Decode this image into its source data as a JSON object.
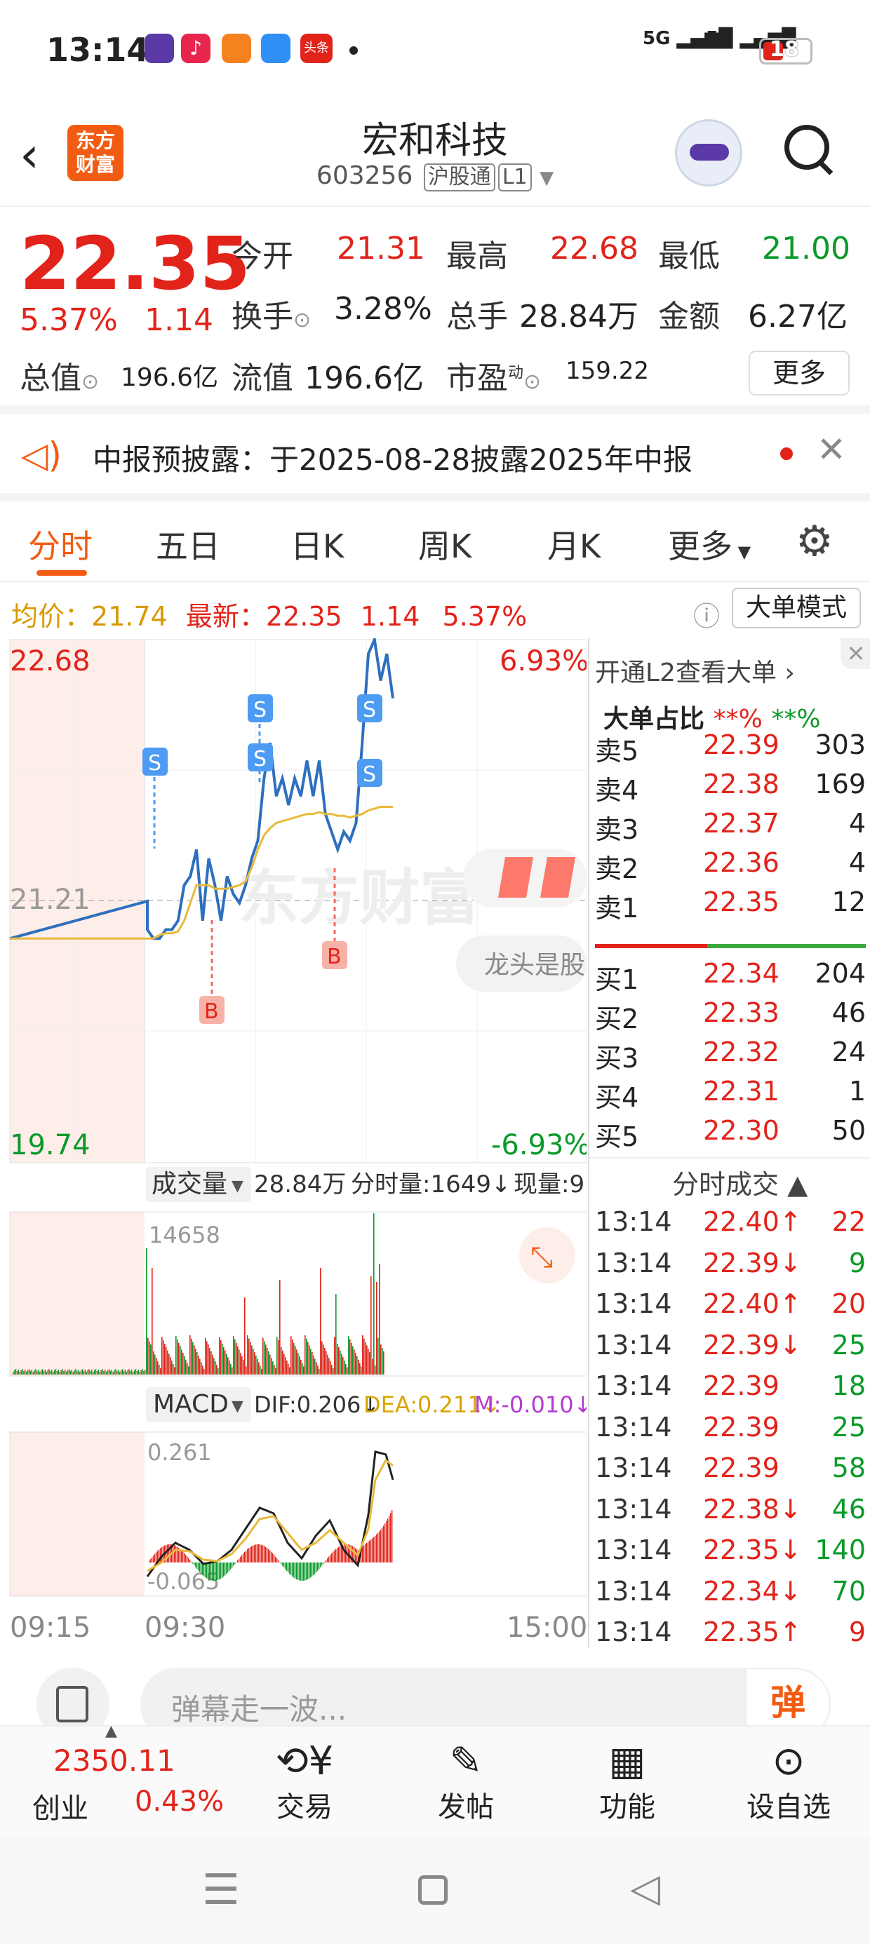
{
  "status": {
    "time": "13:14",
    "battery": "18",
    "sig1": "5G",
    "sig2": "5G",
    "app5": "头条"
  },
  "header": {
    "title": "宏和科技",
    "code": "603256",
    "tag1": "沪股通",
    "tag2": "L1",
    "logo_top": "东方",
    "logo_bottom": "财富"
  },
  "quote": {
    "price": "22.35",
    "pct": "5.37%",
    "chg": "1.14",
    "open_l": "今开",
    "open": "21.31",
    "high_l": "最高",
    "high": "22.68",
    "low_l": "最低",
    "low": "21.00",
    "turn_l": "换手",
    "turn": "3.28%",
    "vol_l": "总手",
    "vol": "28.84万",
    "amt_l": "金额",
    "amt": "6.27亿",
    "mcap_l": "总值",
    "mcap": "196.6亿",
    "float_l": "流值",
    "float": "196.6亿",
    "pe_l": "市盈",
    "pe_sup": "动",
    "pe": "159.22",
    "more": "更多"
  },
  "notice": {
    "text": "中报预披露：于2025-08-28披露2025年中报"
  },
  "tabs": [
    "分时",
    "五日",
    "日K",
    "周K",
    "月K",
    "更多"
  ],
  "priceline": {
    "avg_l": "均价：",
    "avg": "21.74",
    "last_l": "最新：",
    "last": "22.35",
    "chg": "1.14",
    "pct": "5.37%",
    "btn": "大单模式"
  },
  "chart": {
    "high": "22.68",
    "low": "19.74",
    "mid": "21.21",
    "uppct": "6.93%",
    "lowpct": "-6.93%",
    "watermark": "东方财富",
    "popup": "龙头是股",
    "vol_label": "成交量",
    "vol_total": "28.84万",
    "vol_min": "分时量:1649↓",
    "vol_now": "现量:9",
    "vol_max": "14658",
    "macd_label": "MACD",
    "dif": "DIF:0.206↓",
    "dea": "DEA:0.211↓",
    "m": "M:-0.010↓",
    "macd_max": "0.261",
    "macd_min": "-0.065",
    "t1": "09:15",
    "t2": "09:30",
    "t3": "15:00",
    "s": "S",
    "b": "B"
  },
  "chart_data": {
    "type": "line",
    "x": [
      "09:15",
      "09:30",
      "15:00"
    ],
    "ylim": [
      19.74,
      22.68
    ],
    "prev_close": 21.21,
    "price_series": [
      21.0,
      21.21,
      21.05,
      21.0,
      21.0,
      21.05,
      21.05,
      21.1,
      21.3,
      21.35,
      21.5,
      21.1,
      21.45,
      21.3,
      21.1,
      21.35,
      21.25,
      21.2,
      21.3,
      21.45,
      21.55,
      21.9,
      22.1,
      21.8,
      21.9,
      21.75,
      21.9,
      21.8,
      22.0,
      21.8,
      22.0,
      21.7,
      21.6,
      21.5,
      21.6,
      21.55,
      21.65,
      22.1,
      22.6,
      22.68,
      22.45,
      22.6,
      22.35
    ],
    "avg_series": [
      21.0,
      21.0,
      21.0,
      21.0,
      21.02,
      21.03,
      21.03,
      21.04,
      21.1,
      21.2,
      21.3,
      21.3,
      21.3,
      21.28,
      21.28,
      21.28,
      21.29,
      21.3,
      21.32,
      21.4,
      21.5,
      21.58,
      21.62,
      21.65,
      21.66,
      21.67,
      21.68,
      21.69,
      21.7,
      21.7,
      21.71,
      21.7,
      21.7,
      21.69,
      21.69,
      21.68,
      21.69,
      21.7,
      21.72,
      21.73,
      21.74,
      21.74,
      21.74
    ]
  },
  "ladder": {
    "top": "开通L2查看大单",
    "ratio_l": "大单占比",
    "r1": "**%",
    "r2": "**%",
    "asks": [
      [
        "卖5",
        "22.39",
        "303"
      ],
      [
        "卖4",
        "22.38",
        "169"
      ],
      [
        "卖3",
        "22.37",
        "4"
      ],
      [
        "卖2",
        "22.36",
        "4"
      ],
      [
        "卖1",
        "22.35",
        "12"
      ]
    ],
    "bids": [
      [
        "买1",
        "22.34",
        "204"
      ],
      [
        "买2",
        "22.33",
        "46"
      ],
      [
        "买3",
        "22.32",
        "24"
      ],
      [
        "买4",
        "22.31",
        "1"
      ],
      [
        "买5",
        "22.30",
        "50"
      ]
    ],
    "trade_title": "分时成交",
    "trades": [
      [
        "13:14",
        "22.40↑",
        "22",
        "up"
      ],
      [
        "13:14",
        "22.39↓",
        "9",
        "dn"
      ],
      [
        "13:14",
        "22.40↑",
        "20",
        "up"
      ],
      [
        "13:14",
        "22.39↓",
        "25",
        "dn"
      ],
      [
        "13:14",
        "22.39",
        "18",
        "dn"
      ],
      [
        "13:14",
        "22.39",
        "25",
        "dn"
      ],
      [
        "13:14",
        "22.39",
        "58",
        "dn"
      ],
      [
        "13:14",
        "22.38↓",
        "46",
        "dn"
      ],
      [
        "13:14",
        "22.35↓",
        "140",
        "dn"
      ],
      [
        "13:14",
        "22.34↓",
        "70",
        "dn"
      ],
      [
        "13:14",
        "22.35↑",
        "9",
        "up"
      ]
    ]
  },
  "comment": {
    "placeholder": "弹幕走一波...",
    "btn": "弹"
  },
  "bottom": {
    "index_val": "2350.11",
    "index_name": "创业",
    "index_pct": "0.43%",
    "items": [
      "交易",
      "发帖",
      "功能",
      "设自选"
    ]
  }
}
